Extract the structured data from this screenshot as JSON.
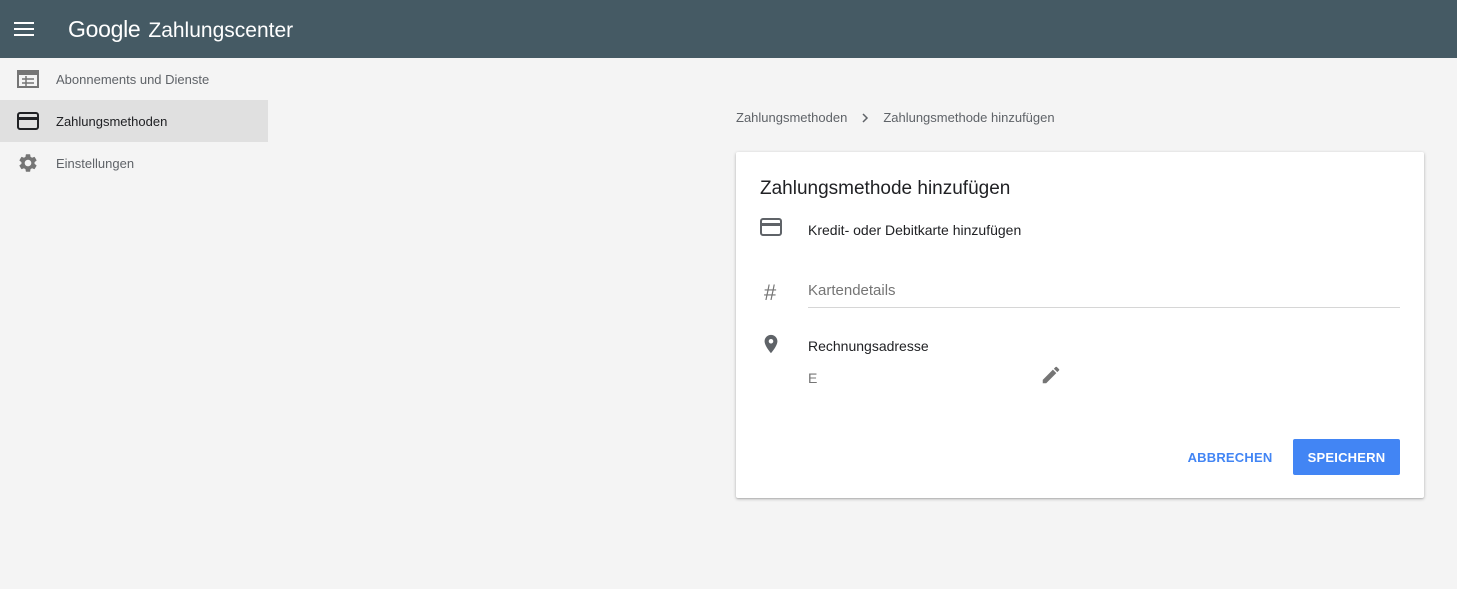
{
  "app": {
    "brand": "Google",
    "product": "Zahlungscenter",
    "menu_icon": "menu-icon"
  },
  "sidebar": {
    "items": [
      {
        "label": "Abonnements und Dienste",
        "icon": "subscriptions-icon",
        "active": false
      },
      {
        "label": "Zahlungsmethoden",
        "icon": "credit-card-icon",
        "active": true
      },
      {
        "label": "Einstellungen",
        "icon": "gear-icon",
        "active": false
      }
    ]
  },
  "breadcrumb": {
    "items": [
      "Zahlungsmethoden",
      "Zahlungsmethode hinzufügen"
    ],
    "separator_icon": "chevron-right-icon"
  },
  "card": {
    "title": "Zahlungsmethode hinzufügen",
    "add_card_label": "Kredit- oder Debitkarte hinzufügen",
    "card_details_placeholder": "Kartendetails",
    "card_details_value": "",
    "hash_symbol": "#",
    "billing_address_title": "Rechnungsadresse",
    "billing_address_value": "E",
    "cancel_label": "ABBRECHEN",
    "save_label": "SPEICHERN"
  },
  "colors": {
    "topbar": "#455a64",
    "background": "#f4f4f4",
    "accent": "#4285f4",
    "active_nav": "#e0e0e0"
  }
}
